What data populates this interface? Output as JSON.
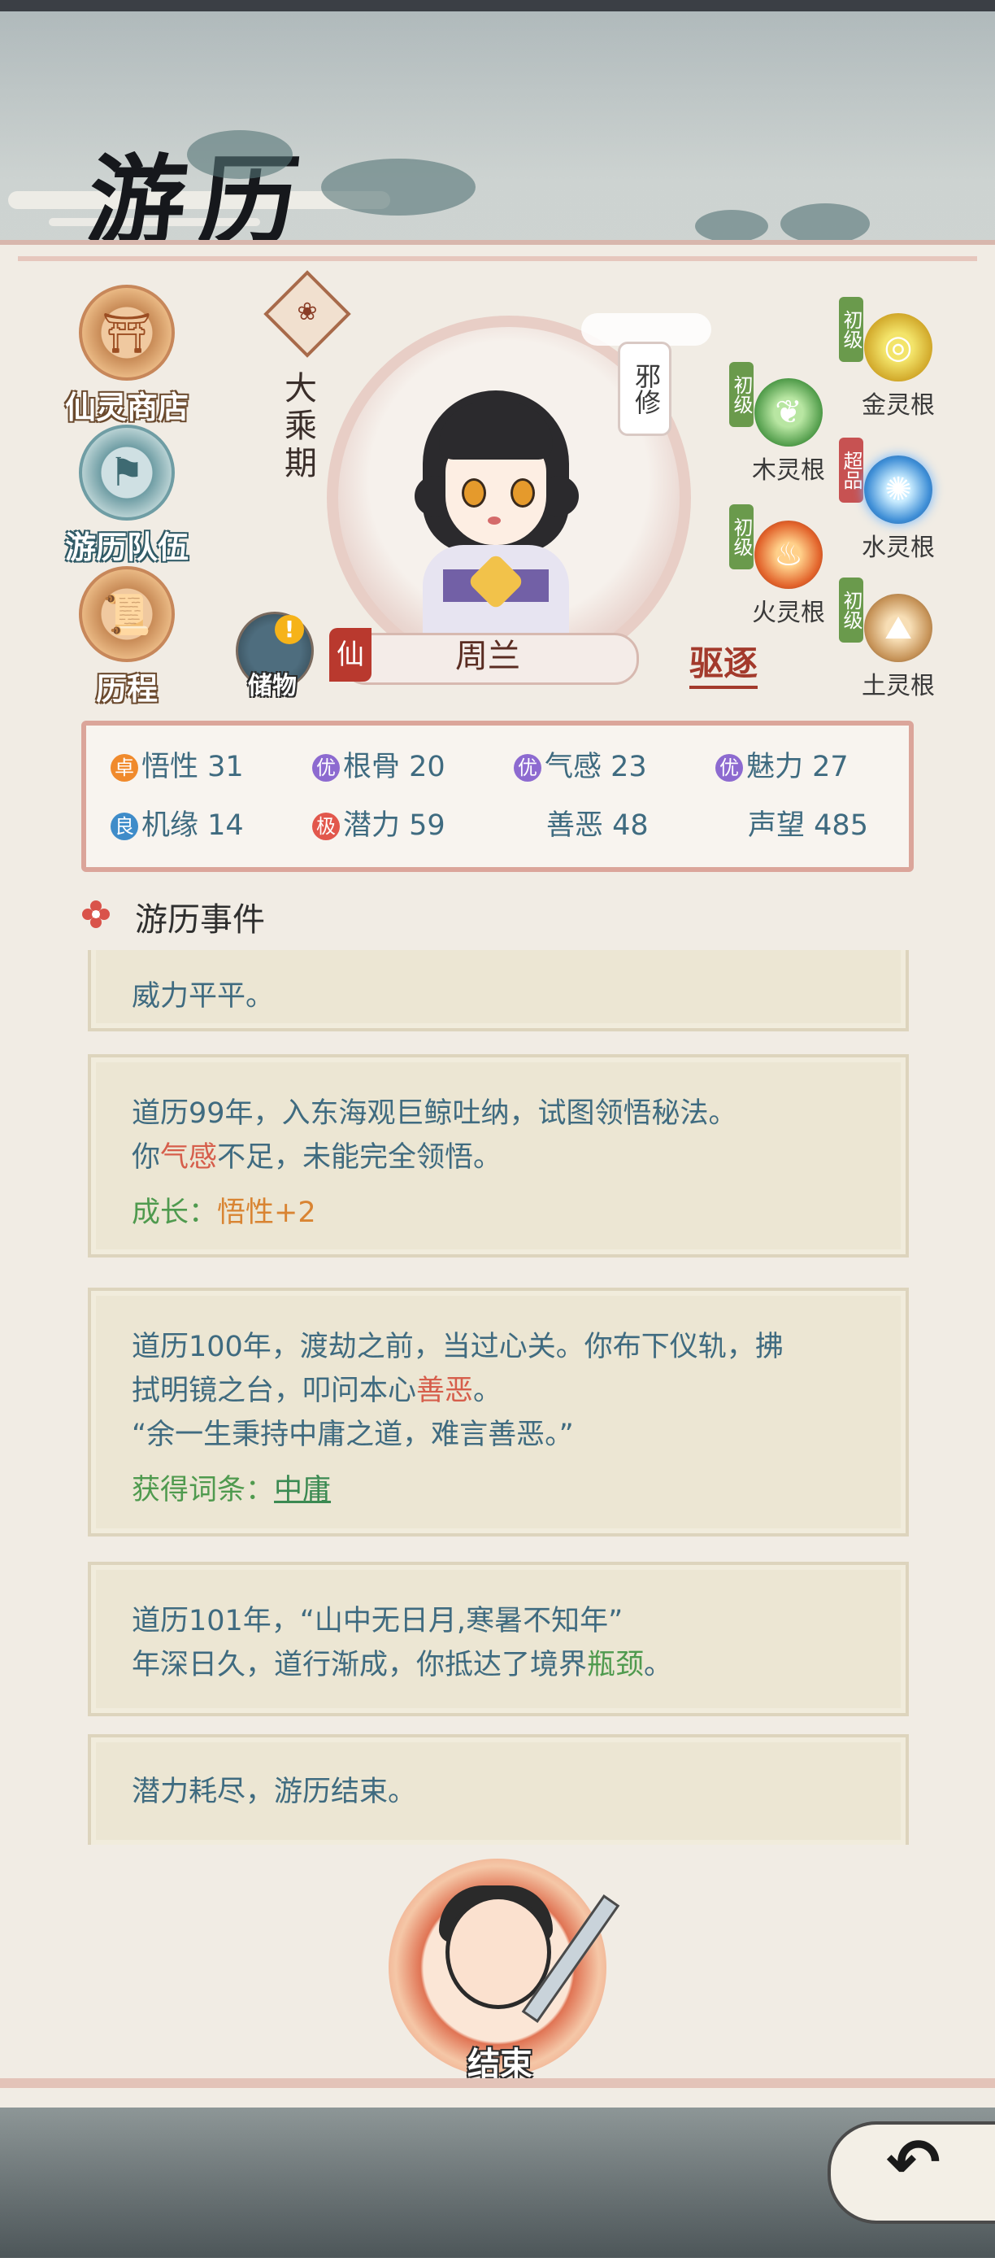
{
  "header": {
    "title": "游历"
  },
  "menu": [
    {
      "label": "仙灵商店",
      "icon": "shop-icon"
    },
    {
      "label": "游历队伍",
      "icon": "team-flag-icon"
    },
    {
      "label": "历程",
      "icon": "scroll-icon"
    }
  ],
  "character": {
    "realm": "大乘期",
    "sect_tag": "邪修",
    "title_badge": "仙",
    "name": "周兰",
    "storage_label": "储物",
    "storage_alert": "!",
    "expel_label": "驱逐"
  },
  "spirit_roots": [
    {
      "name": "金灵根",
      "tier": "初级",
      "icon": "gold-root-icon"
    },
    {
      "name": "木灵根",
      "tier": "初级",
      "icon": "wood-root-icon"
    },
    {
      "name": "水灵根",
      "tier": "超品",
      "icon": "water-root-icon"
    },
    {
      "name": "火灵根",
      "tier": "初级",
      "icon": "fire-root-icon"
    },
    {
      "name": "土灵根",
      "tier": "初级",
      "icon": "earth-root-icon"
    }
  ],
  "stats": [
    {
      "badge": "卓",
      "label": "悟性",
      "value": "31",
      "badge_color": "#f08a2c"
    },
    {
      "badge": "优",
      "label": "根骨",
      "value": "20",
      "badge_color": "#8d6ad0"
    },
    {
      "badge": "优",
      "label": "气感",
      "value": "23",
      "badge_color": "#8d6ad0"
    },
    {
      "badge": "优",
      "label": "魅力",
      "value": "27",
      "badge_color": "#8d6ad0"
    },
    {
      "badge": "良",
      "label": "机缘",
      "value": "14",
      "badge_color": "#3f8cc9"
    },
    {
      "badge": "极",
      "label": "潜力",
      "value": "59",
      "badge_color": "#e2574c"
    },
    {
      "badge": "",
      "label": "善恶",
      "value": "48"
    },
    {
      "badge": "",
      "label": "声望",
      "value": "485"
    }
  ],
  "events": {
    "header": "游历事件",
    "cards": [
      {
        "lines": [
          "威力平平。"
        ]
      },
      {
        "line1": "道历99年，入东海观巨鲸吐纳，试图领悟秘法。",
        "line2_pre": "你",
        "line2_hl": "气感",
        "line2_post": "不足，未能完全领悟。",
        "growth_label": "成长：",
        "growth_value": "悟性+2"
      },
      {
        "line1": "道历100年，渡劫之前，当过心关。你布下仪轨，拂",
        "line2_pre": "拭明镜之台，叩问本心",
        "line2_hl": "善恶",
        "line2_post": "。",
        "line3": "“余一生秉持中庸之道，难言善恶。”",
        "reward_label": "获得词条：",
        "reward_value": "中庸"
      },
      {
        "line1": "道历101年，“山中无日月,寒暑不知年”",
        "line2_pre": "年深日久，道行渐成，你抵达了境界",
        "line2_hl": "瓶颈",
        "line2_post": "。"
      },
      {
        "line1": "潜力耗尽，游历结束。"
      }
    ]
  },
  "end_button": {
    "label": "结束"
  },
  "back_button": {
    "icon": "back-arrow-icon",
    "glyph": "↶"
  }
}
